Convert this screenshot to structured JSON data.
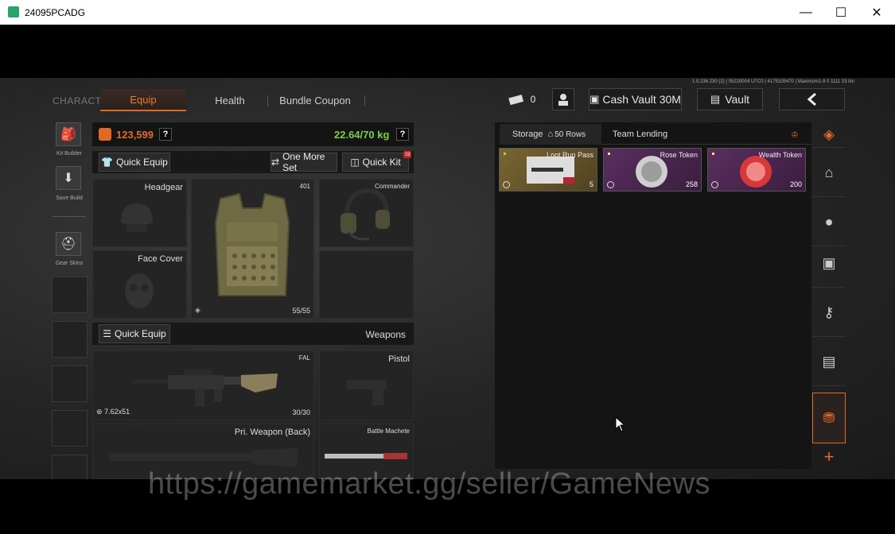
{
  "window": {
    "title": "24095PCADG",
    "controls": {
      "minimize": "—",
      "maximize": "☐",
      "close": "✕"
    }
  },
  "build_info": "1.0.236.230 (2) | 05220004 UTC0 | 4175105470 | Maximum1-8 0 1111 23 lim",
  "header": {
    "character_label": "CHARACTER",
    "tabs": [
      "Equip",
      "Health",
      "Bundle Coupon"
    ],
    "active_tab": "Equip",
    "ticket_count": "0",
    "cash_vault": "Cash Vault 30M",
    "vault": "Vault",
    "back_icon": "chevron-left-icon"
  },
  "left_sidebar": {
    "kit_builder": "Kit Builder",
    "save_build": "Save Build",
    "gear_skins": "Gear Skins"
  },
  "stats": {
    "money": "123,599",
    "weight": "22.64/70 kg",
    "help": "?"
  },
  "actions": {
    "quick_equip": "Quick Equip",
    "one_more_set": "One More Set",
    "quick_kit": "Quick Kit",
    "quick_kit_badge": "19"
  },
  "gear": {
    "headgear": "Headgear",
    "face_cover": "Face Cover",
    "armor_level": "401",
    "armor_durability": "55/55",
    "headset": "Commander"
  },
  "weapons": {
    "section_label": "Weapons",
    "quick_equip": "Quick Equip",
    "primary_name": "FAL",
    "primary_caliber": "7.62x51",
    "primary_ammo": "30/30",
    "pistol": "Pistol",
    "back_weapon": "Pri. Weapon (Back)",
    "melee": "Battle Machete"
  },
  "storage": {
    "tab_label": "Storage",
    "rows": "50 Rows",
    "team_lending": "Team Lending",
    "items": [
      {
        "name": "Loot Run Pass",
        "count": "5",
        "color": "#6e5a2e"
      },
      {
        "name": "Rose Token",
        "count": "258",
        "color": "#4e2a52"
      },
      {
        "name": "Wealth Token",
        "count": "200",
        "color": "#4e2a52"
      }
    ]
  },
  "watermark": "https://gamemarket.gg/seller/GameNews",
  "colors": {
    "accent": "#e06a20",
    "weight_ok": "#7bd13b"
  }
}
